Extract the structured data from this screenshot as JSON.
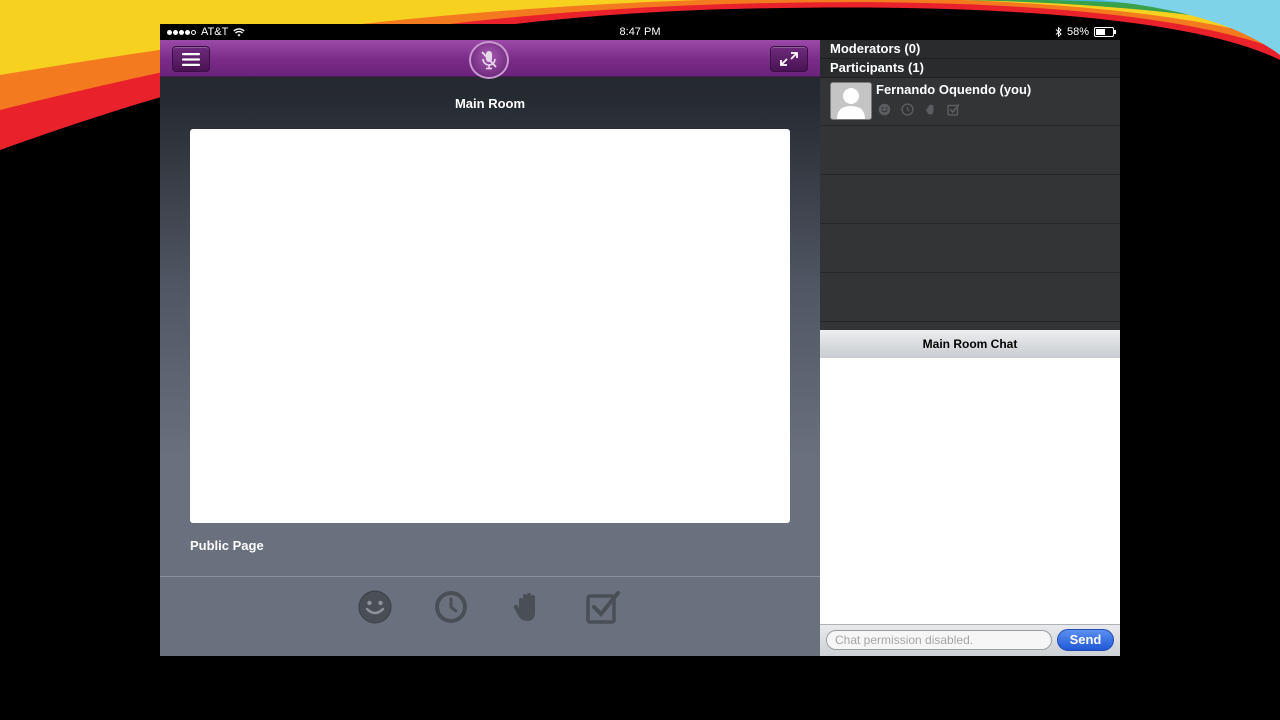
{
  "status_bar": {
    "carrier": "AT&T",
    "time": "8:47 PM",
    "battery": "58%",
    "battery_level": 0.58,
    "bluetooth_icon": "bluetooth-icon",
    "wifi_icon": "wifi-icon"
  },
  "toolbar": {
    "menu_icon": "hamburger-menu-icon",
    "mic_icon": "microphone-muted-icon",
    "expand_icon": "expand-arrows-icon"
  },
  "main": {
    "room_title": "Main Room",
    "page_label": "Public Page",
    "status_icons": [
      "smiley-icon",
      "clock-icon",
      "raised-hand-icon",
      "checkbox-icon"
    ]
  },
  "sidebar": {
    "moderators_header": "Moderators (0)",
    "participants_header": "Participants (1)",
    "participants": [
      {
        "name": "Fernando Oquendo (you)"
      }
    ]
  },
  "chat": {
    "title": "Main Room Chat",
    "input_placeholder": "Chat permission disabled.",
    "send_label": "Send"
  },
  "colors": {
    "toolbar_purple": "#7a2b87",
    "send_blue": "#2f6ae0",
    "panel_gray": "#333436"
  }
}
